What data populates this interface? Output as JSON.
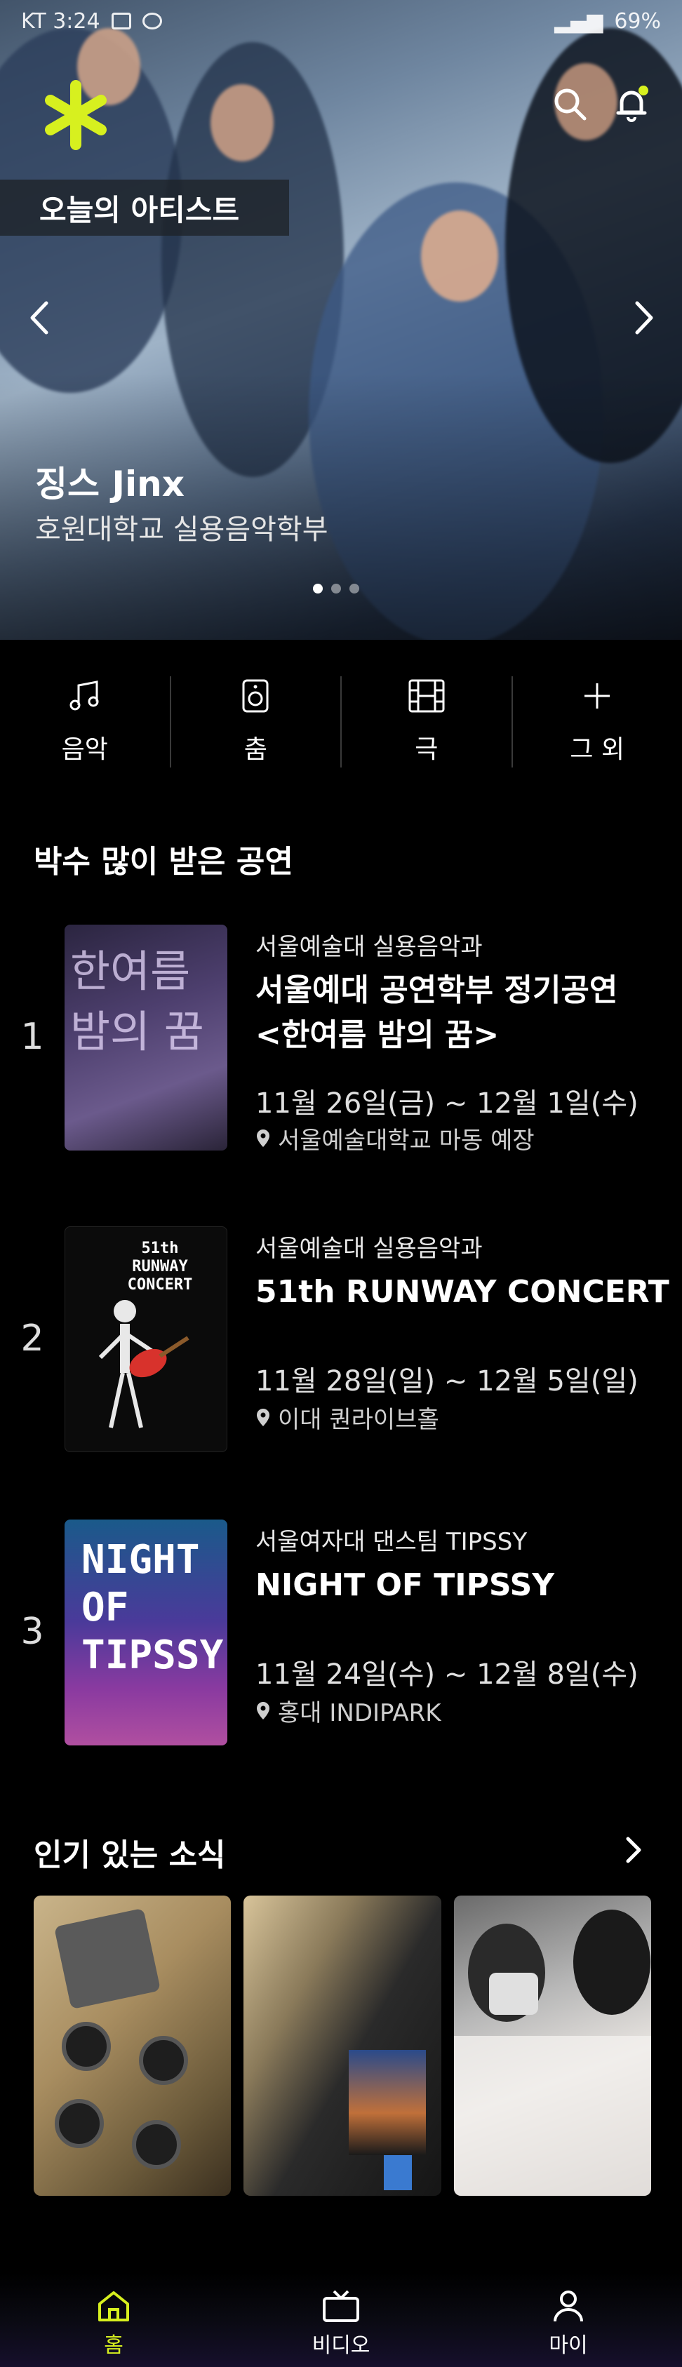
{
  "status_bar": {
    "carrier_time": "KT 3:24",
    "battery": "69%"
  },
  "hero": {
    "tag": "오늘의 아티스트",
    "artist_name": "징스 Jinx",
    "artist_school": "호원대학교 실용음악학부",
    "slide_count": 3,
    "active_slide": 1
  },
  "categories": [
    {
      "label": "음악",
      "icon": "music-note-icon"
    },
    {
      "label": "춤",
      "icon": "speaker-icon"
    },
    {
      "label": "극",
      "icon": "film-icon"
    },
    {
      "label": "그 외",
      "icon": "plus-icon"
    }
  ],
  "popular_shows": {
    "title": "박수 많이 받은 공연",
    "items": [
      {
        "rank": "1",
        "org": "서울예술대 실용음악과",
        "title_line1": "서울예대 공연학부 정기공연",
        "title_line2": "<한여름 밤의 꿈>",
        "dates": "11월 26일(금) ~ 12월 1일(수)",
        "venue": "서울예술대학교 마동 예장"
      },
      {
        "rank": "2",
        "org": "서울예술대 실용음악과",
        "title_line1": "51th RUNWAY CONCERT",
        "title_line2": "",
        "dates": "11월 28일(일) ~ 12월 5일(일)",
        "venue": "이대 퀀라이브홀"
      },
      {
        "rank": "3",
        "org": "서울여자대 댄스팀 TIPSSY",
        "title_line1": "NIGHT OF TIPSSY",
        "title_line2": "",
        "dates": "11월 24일(수) ~ 12월 8일(수)",
        "venue": "홍대 INDIPARK"
      }
    ]
  },
  "posters": {
    "p1": "한여름 밤의 꿈",
    "p2a": "51th",
    "p2b": "RUNWAY",
    "p2c": "CONCERT",
    "p3a": "NIGHT",
    "p3b": "OF",
    "p3c": "TIPSSY"
  },
  "news": {
    "title": "인기 있는 소식"
  },
  "bottom_nav": [
    {
      "label": "홈",
      "active": true
    },
    {
      "label": "비디오",
      "active": false
    },
    {
      "label": "마이",
      "active": false
    }
  ],
  "colors": {
    "accent": "#d7f01f",
    "background": "#000000"
  }
}
